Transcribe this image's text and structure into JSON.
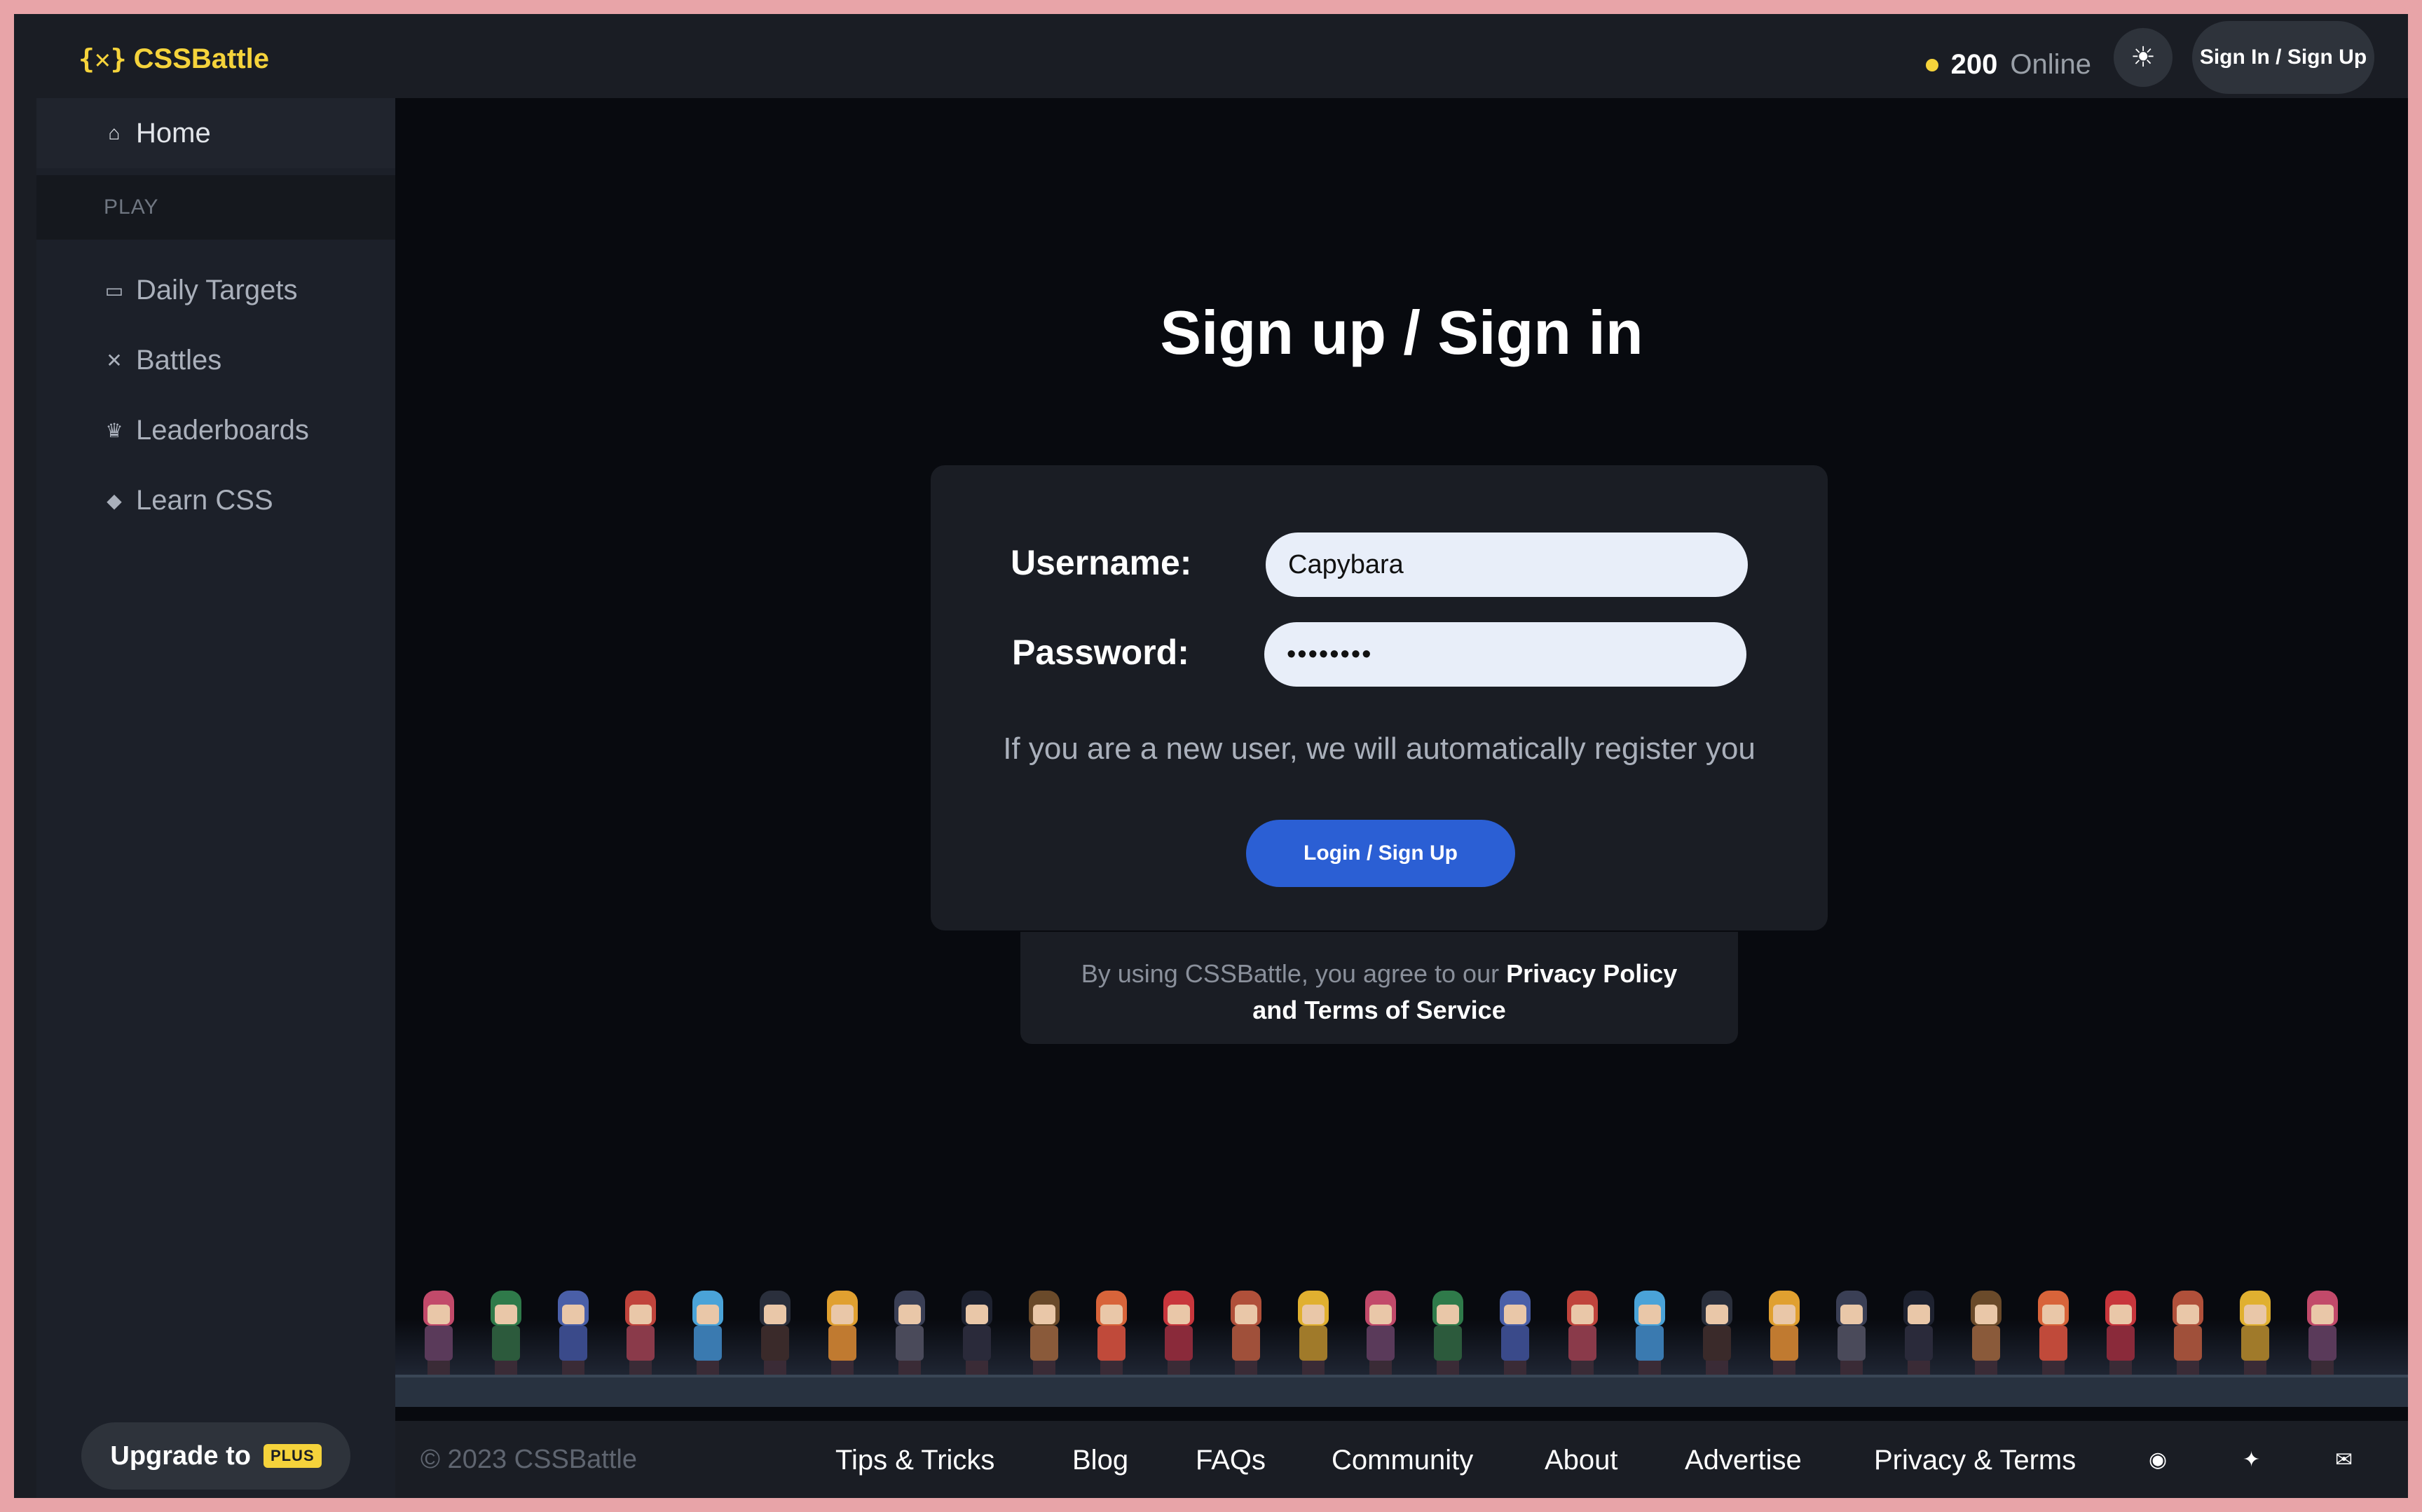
{
  "brand": {
    "logo_mark": "{✕}",
    "name": "CSSBattle",
    "color": "#f5d33b"
  },
  "header": {
    "online_count": "200",
    "online_label": "Online",
    "theme_icon": "sun-icon",
    "signin_label": "Sign In / Sign Up"
  },
  "sidebar": {
    "home": {
      "label": "Home",
      "icon": "home-icon"
    },
    "section_label": "PLAY",
    "items": [
      {
        "label": "Daily Targets",
        "icon": "calendar-icon"
      },
      {
        "label": "Battles",
        "icon": "crossed-swords-icon"
      },
      {
        "label": "Leaderboards",
        "icon": "trophy-icon"
      },
      {
        "label": "Learn CSS",
        "icon": "graduation-cap-icon"
      }
    ],
    "upgrade_label": "Upgrade to",
    "upgrade_badge": "PLUS"
  },
  "main": {
    "heading": "Sign up / Sign in",
    "form": {
      "username_label": "Username:",
      "username_value": "Capybara",
      "password_label": "Password:",
      "password_value": "••••••••",
      "note": "If you are a new user, we will automatically register you",
      "submit_label": "Login / Sign Up"
    },
    "terms": {
      "prefix": "By using CSSBattle, you agree to our",
      "privacy_link": "Privacy Policy",
      "terms_link": "and Terms of Service"
    }
  },
  "footer": {
    "copyright": "© 2023 CSSBattle",
    "links": [
      "Tips & Tricks",
      "Blog",
      "FAQs",
      "Community",
      "About",
      "Advertise",
      "Privacy & Terms"
    ],
    "icons": [
      "discord-icon",
      "twitter-icon",
      "email-icon"
    ]
  },
  "colors": {
    "accent": "#f5d33b",
    "primary_button": "#2b5fd4",
    "background": "#080a0f",
    "panel": "#1a1d24"
  }
}
